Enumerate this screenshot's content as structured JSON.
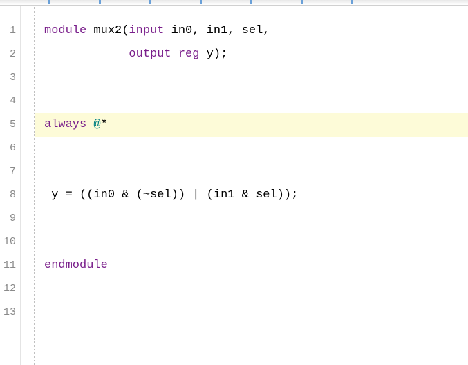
{
  "lines": {
    "l1": "1",
    "l2": "2",
    "l3": "3",
    "l4": "4",
    "l5": "5",
    "l6": "6",
    "l7": "7",
    "l8": "8",
    "l9": "9",
    "l10": "10",
    "l11": "11",
    "l12": "12",
    "l13": "13"
  },
  "code": {
    "l1": {
      "kw_module": "module",
      "id_mux2": " mux2",
      "p_open": "(",
      "kw_input": "input",
      "id_in0": " in0",
      "comma1": ", ",
      "id_in1": "in1",
      "comma2": ", ",
      "id_sel": "sel",
      "comma3": ","
    },
    "l2": {
      "indent": "            ",
      "kw_output": "output",
      "sp1": " ",
      "kw_reg": "reg",
      "id_y": " y",
      "p_close": ")",
      "semi": ";"
    },
    "l3": "",
    "l4": "",
    "l5": {
      "kw_always": "always",
      "sp": " ",
      "at": "@",
      "star": "*"
    },
    "l6": "",
    "l7": "",
    "l8": {
      "indent": " ",
      "id_y": "y",
      "eq": " = ",
      "p1": "((",
      "id_in0": "in0",
      "and1": " & ",
      "p2": "(",
      "not": "~",
      "id_sel1": "sel",
      "p3": "))",
      "or": " | ",
      "p4": "(",
      "id_in1": "in1",
      "and2": " & ",
      "id_sel2": "sel",
      "p5": "))",
      "semi": ";"
    },
    "l9": "",
    "l10": "",
    "l11": {
      "kw_endmodule": "endmodule"
    },
    "l12": "",
    "l13": ""
  },
  "highlighted_line": 5
}
